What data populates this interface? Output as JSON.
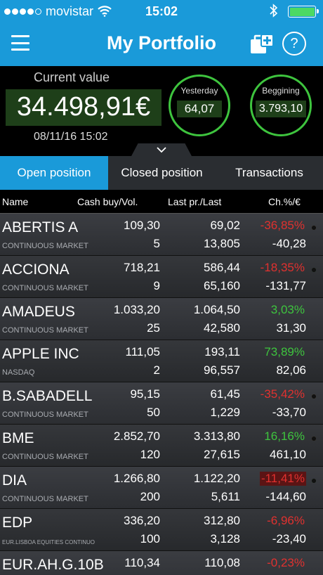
{
  "status_bar": {
    "carrier": "movistar",
    "time": "15:02"
  },
  "nav": {
    "title": "My Portfolio",
    "help_label": "?"
  },
  "summary": {
    "current_label": "Current value",
    "current_value": "34.498,91€",
    "date": "08/11/16 15:02",
    "yesterday_label": "Yesterday",
    "yesterday_value": "64,07",
    "beginning_label": "Beggining",
    "beginning_value": "3.793,10"
  },
  "tabs": [
    {
      "label": "Open position",
      "active": true
    },
    {
      "label": "Closed position",
      "active": false
    },
    {
      "label": "Transactions",
      "active": false
    }
  ],
  "columns": {
    "name": "Name",
    "cash_buy": "Cash buy/Vol.",
    "last": "Last pr./Last",
    "change": "Ch.%/€"
  },
  "colors": {
    "accent": "#1a9ad9",
    "positive": "#3ec43e",
    "negative": "#e0312f",
    "value_bg": "#1e3f19"
  },
  "rows": [
    {
      "name": "ABERTIS A",
      "market": "CONTINUOUS MARKET",
      "cash_buy": "109,30",
      "vol": "5",
      "last_price": "69,02",
      "last": "13,805",
      "change_pct": "-36,85%",
      "change_eur": "-40,28",
      "trend": "neg",
      "dots": [
        "y",
        "n",
        "n"
      ]
    },
    {
      "name": "ACCIONA",
      "market": "CONTINUOUS MARKET",
      "cash_buy": "718,21",
      "vol": "9",
      "last_price": "586,44",
      "last": "65,160",
      "change_pct": "-18,35%",
      "change_eur": "-131,77",
      "trend": "neg",
      "dots": [
        "g",
        "n",
        "n"
      ]
    },
    {
      "name": "AMADEUS",
      "market": "CONTINUOUS MARKET",
      "cash_buy": "1.033,20",
      "vol": "25",
      "last_price": "1.064,50",
      "last": "42,580",
      "change_pct": "3,03%",
      "change_eur": "31,30",
      "trend": "pos",
      "dots": []
    },
    {
      "name": "APPLE INC",
      "market": "NASDAQ",
      "cash_buy": "111,05",
      "vol": "2",
      "last_price": "193,11",
      "last": "96,557",
      "change_pct": "73,89%",
      "change_eur": "82,06",
      "trend": "pos",
      "dots": []
    },
    {
      "name": "B.SABADELL",
      "market": "CONTINUOUS MARKET",
      "cash_buy": "95,15",
      "vol": "50",
      "last_price": "61,45",
      "last": "1,229",
      "change_pct": "-35,42%",
      "change_eur": "-33,70",
      "trend": "neg",
      "dots": [
        "n",
        "y",
        "n"
      ]
    },
    {
      "name": "BME",
      "market": "CONTINUOUS MARKET",
      "cash_buy": "2.852,70",
      "vol": "120",
      "last_price": "3.313,80",
      "last": "27,615",
      "change_pct": "16,16%",
      "change_eur": "461,10",
      "trend": "pos",
      "dots": [
        "n",
        "y",
        "n"
      ]
    },
    {
      "name": "DIA",
      "market": "CONTINUOUS MARKET",
      "cash_buy": "1.266,80",
      "vol": "200",
      "last_price": "1.122,20",
      "last": "5,611",
      "change_pct": "-11,41%",
      "change_eur": "-144,60",
      "trend": "neghl",
      "dots": [
        "g",
        "n",
        "n"
      ]
    },
    {
      "name": "EDP",
      "market": "EUR.LISBOA EQUITIES CONTINUO",
      "cash_buy": "336,20",
      "vol": "100",
      "last_price": "312,80",
      "last": "3,128",
      "change_pct": "-6,96%",
      "change_eur": "-23,40",
      "trend": "neg",
      "dots": [],
      "small_market": true
    },
    {
      "name": "EUR.AH.G.10B",
      "market": "",
      "cash_buy": "110,34",
      "vol": "",
      "last_price": "110,08",
      "last": "",
      "change_pct": "-0,23%",
      "change_eur": "",
      "trend": "neg",
      "dots": []
    }
  ]
}
